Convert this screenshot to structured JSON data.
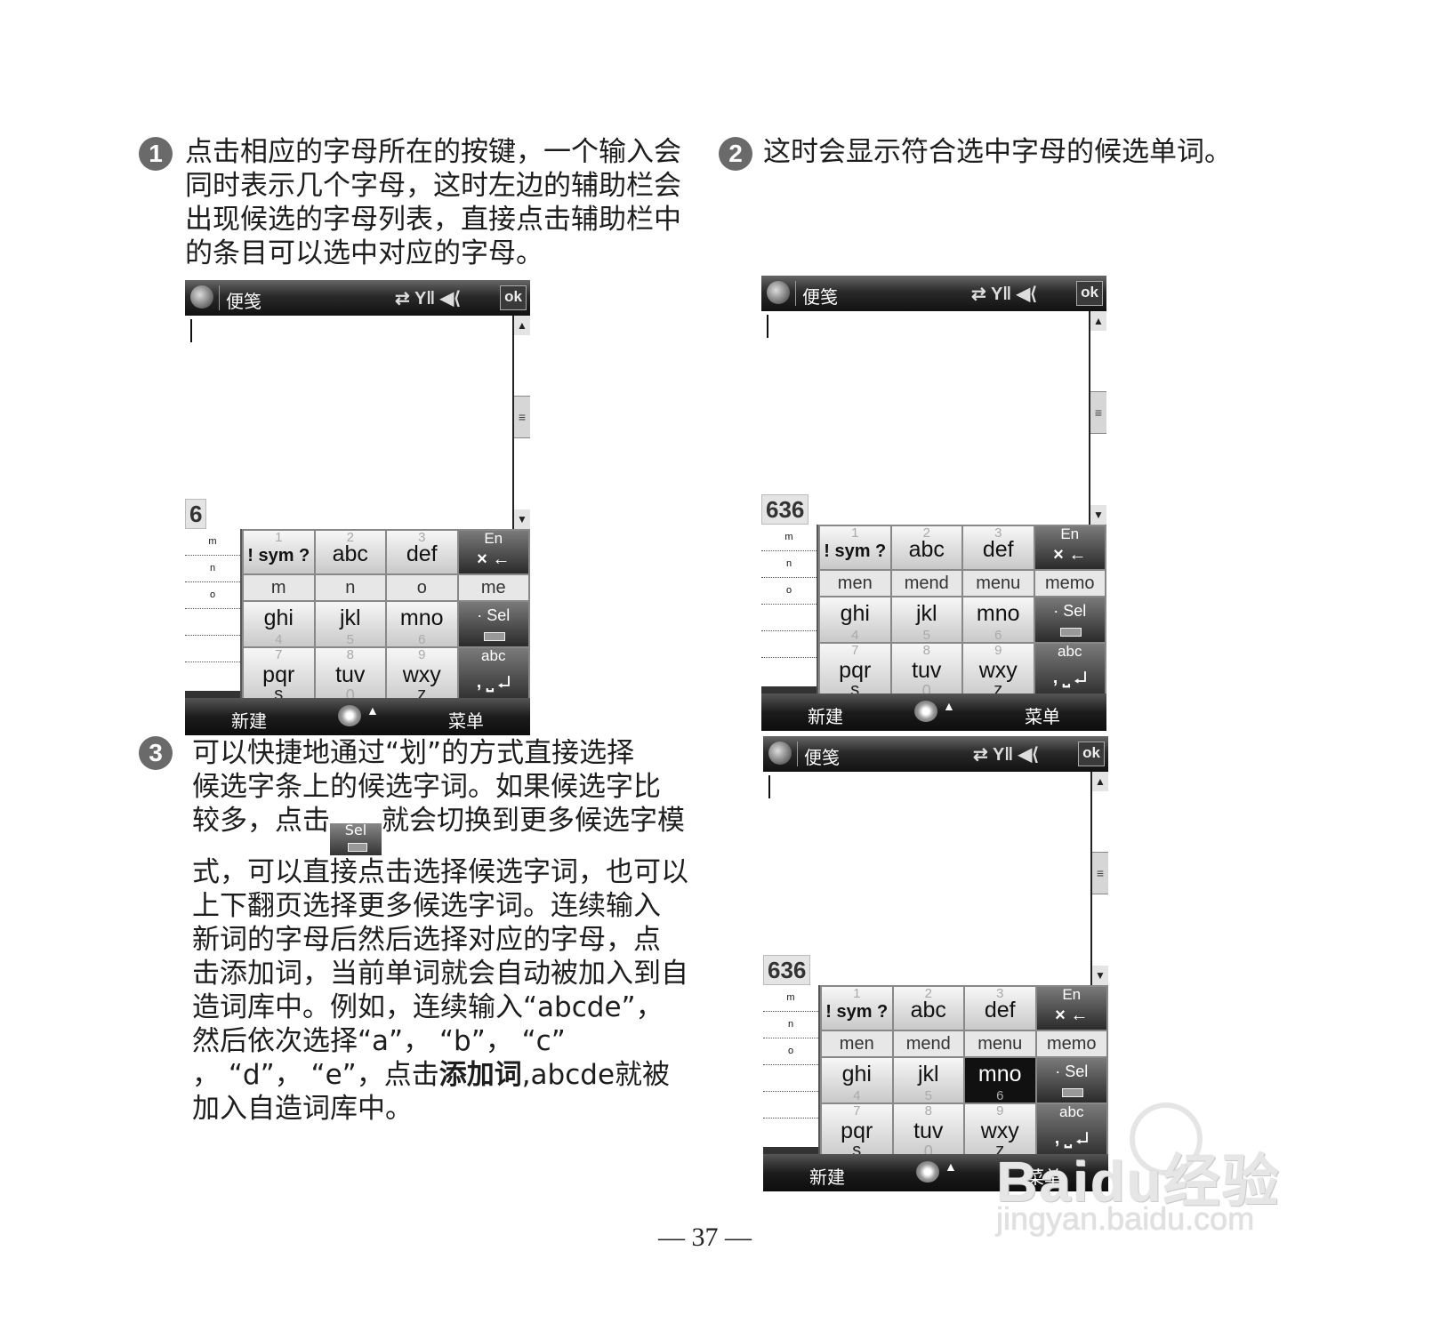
{
  "steps": [
    {
      "num": "1",
      "lines": [
        "点击相应的字母所在的按键，一个输入会",
        "同时表示几个字母，这时左边的辅助栏会",
        "出现候选的字母列表，直接点击辅助栏中",
        "的条目可以选中对应的字母。"
      ]
    },
    {
      "num": "2",
      "lines": [
        "这时会显示符合选中字母的候选单词。"
      ]
    },
    {
      "num": "3",
      "lines": [
        "可以快捷地通过“划”的方式直接选择",
        "候选字条上的候选字词。如果候选字比"
      ],
      "line3_pre": "较多，点击",
      "line3_post": "就会切换到更多候选字模",
      "lines_after": [
        "式，可以直接点击选择候选字词，也可以",
        "上下翻页选择更多候选字词。连续输入",
        "新词的字母后然后选择对应的字母，点",
        "击添加词，当前单词就会自动被加入到自",
        "造词库中。例如，连续输入“abcde”，",
        "然后依次选择“a”， “b”， “c”"
      ],
      "last_pre": "， “d”， “e”，点击",
      "last_bold": "添加词",
      "last_post": ",abcde就被",
      "final_line": "加入自造词库中。",
      "inline_sel_label": "Sel"
    }
  ],
  "phone": {
    "app_title": "便笺",
    "status_icons": [
      "sync-icon",
      "signal-icon",
      "volume-icon"
    ],
    "status_glyphs": "⇄ Y‖ ◀⟨",
    "ok_label": "ok",
    "scroll_up": "▲",
    "scroll_thumb": "≡",
    "scroll_down": "▼",
    "aux_letters": [
      "m",
      "n",
      "o"
    ],
    "softkey_left": "新建",
    "softkey_right": "菜单",
    "softkey_caret": "▲",
    "keys": {
      "k1_num": "1",
      "k1_label": "! sym ?",
      "k2_num": "2",
      "k2_label": "abc",
      "k3_num": "3",
      "k3_label": "def",
      "en_label": "En",
      "en_sym": "× ←",
      "k4_num": "4",
      "k4_label": "ghi",
      "k5_num": "5",
      "k5_label": "jkl",
      "k6_num": "6",
      "k6_label": "mno",
      "sel_label": "· Sel",
      "k7_num": "7",
      "k7_label": "pqr",
      "k7_extra": "s",
      "k8_num": "8",
      "k8_label": "tuv",
      "k8_extra": "0",
      "k9_num": "9",
      "k9_label": "wxy",
      "k9_extra": "z",
      "abc_label": "abc",
      "abc_sym": ", ⎵ ↵"
    }
  },
  "screen1": {
    "code": "6",
    "candidates": [
      "m",
      "n",
      "o",
      "me"
    ]
  },
  "screen2": {
    "code": "636",
    "candidates": [
      "men",
      "mend",
      "menu",
      "memo"
    ]
  },
  "screen3": {
    "code": "636",
    "candidates": [
      "men",
      "mend",
      "menu",
      "memo"
    ]
  },
  "page_number": "— 37 —",
  "watermark": {
    "main": "Baidu经验",
    "sub": "jingyan.baidu.com"
  }
}
